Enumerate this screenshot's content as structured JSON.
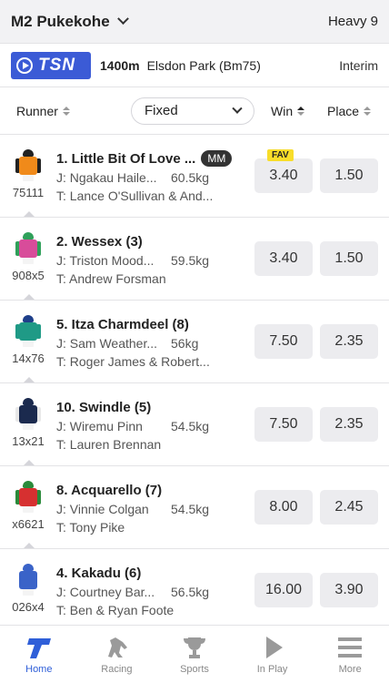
{
  "header": {
    "race": "M2 Pukekohe",
    "track": "Heavy 9"
  },
  "info": {
    "logo_text": "TSN",
    "distance": "1400m",
    "venue": "Elsdon Park (Bm75)",
    "status": "Interim"
  },
  "columns": {
    "runner": "Runner",
    "bet_type": "Fixed",
    "win": "Win",
    "place": "Place"
  },
  "runners": [
    {
      "name": "1. Little Bit Of Love ...",
      "badge": "MM",
      "jockey": "J: Ngakau Haile...",
      "weight": "60.5kg",
      "trainer": "T: Lance O'Sullivan & And...",
      "form": "75111",
      "win": "3.40",
      "place": "1.50",
      "fav": "FAV",
      "silk": {
        "cap": "#222222",
        "body": "#f08a1a",
        "arms": "#222222"
      }
    },
    {
      "name": "2. Wessex (3)",
      "jockey": "J: Triston Mood...",
      "weight": "59.5kg",
      "trainer": "T: Andrew Forsman",
      "form": "908x5",
      "win": "3.40",
      "place": "1.50",
      "silk": {
        "cap": "#2fa05a",
        "body": "#d84c9a",
        "arms": "#2fa05a"
      }
    },
    {
      "name": "5. Itza Charmdeel (8)",
      "jockey": "J: Sam Weather...",
      "weight": "56kg",
      "trainer": "T: Roger James & Robert...",
      "form": "14x76",
      "win": "7.50",
      "place": "2.35",
      "silk": {
        "cap": "#1e3f8a",
        "body": "#1f9a86",
        "arms": "#1f9a86"
      }
    },
    {
      "name": "10. Swindle (5)",
      "jockey": "J: Wiremu Pinn",
      "weight": "54.5kg",
      "trainer": "T: Lauren Brennan",
      "form": "13x21",
      "win": "7.50",
      "place": "2.35",
      "silk": {
        "cap": "#1b2a4e",
        "body": "#1b2a4e",
        "arms": "#e8e8e8"
      }
    },
    {
      "name": "8. Acquarello (7)",
      "jockey": "J: Vinnie Colgan",
      "weight": "54.5kg",
      "trainer": "T: Tony Pike",
      "form": "x6621",
      "win": "8.00",
      "place": "2.45",
      "silk": {
        "cap": "#2a8a3a",
        "body": "#d63030",
        "arms": "#2a8a3a"
      }
    },
    {
      "name": "4. Kakadu (6)",
      "jockey": "J: Courtney Bar...",
      "weight": "56.5kg",
      "trainer": "T: Ben & Ryan Foote",
      "form": "026x4",
      "win": "16.00",
      "place": "3.90",
      "silk": {
        "cap": "#3a63c8",
        "body": "#3a63c8",
        "arms": "#ffffff"
      }
    }
  ],
  "tabs": [
    {
      "label": "Home",
      "icon": "home-icon",
      "active": true
    },
    {
      "label": "Racing",
      "icon": "horse-icon"
    },
    {
      "label": "Sports",
      "icon": "trophy-icon"
    },
    {
      "label": "In Play",
      "icon": "play-icon"
    },
    {
      "label": "More",
      "icon": "menu-icon"
    }
  ],
  "colors": {
    "accent": "#2f5fd8",
    "tsn": "#3b5bd6",
    "fav": "#f8dd2a"
  }
}
